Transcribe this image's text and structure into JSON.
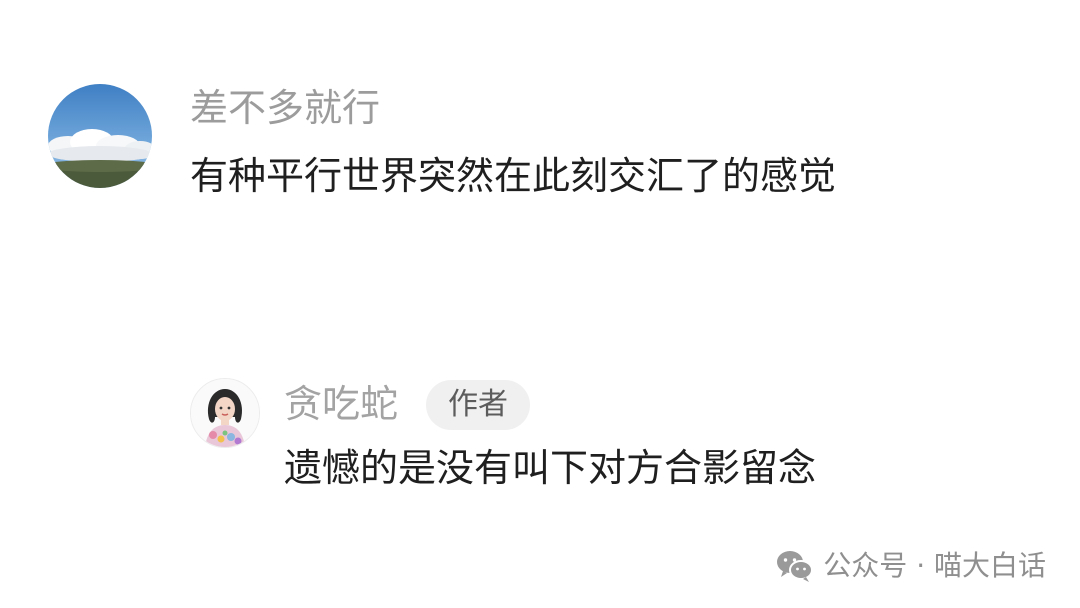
{
  "comments": [
    {
      "username": "差不多就行",
      "text": "有种平行世界突然在此刻交汇了的感觉",
      "avatar_icon": "sky-clouds-avatar"
    },
    {
      "username": "贪吃蛇",
      "badge": "作者",
      "text": "遗憾的是没有叫下对方合影留念",
      "avatar_icon": "illustrated-girl-avatar"
    }
  ],
  "watermark": {
    "text": "公众号 · 喵大白话",
    "icon": "wechat-icon"
  },
  "colors": {
    "background": "#ffffff",
    "username": "#9c9c9c",
    "comment_text": "#1f1f1f",
    "badge_bg": "#f0f0f0",
    "badge_text": "#5c5c5c",
    "watermark": "#8f8f8f"
  }
}
